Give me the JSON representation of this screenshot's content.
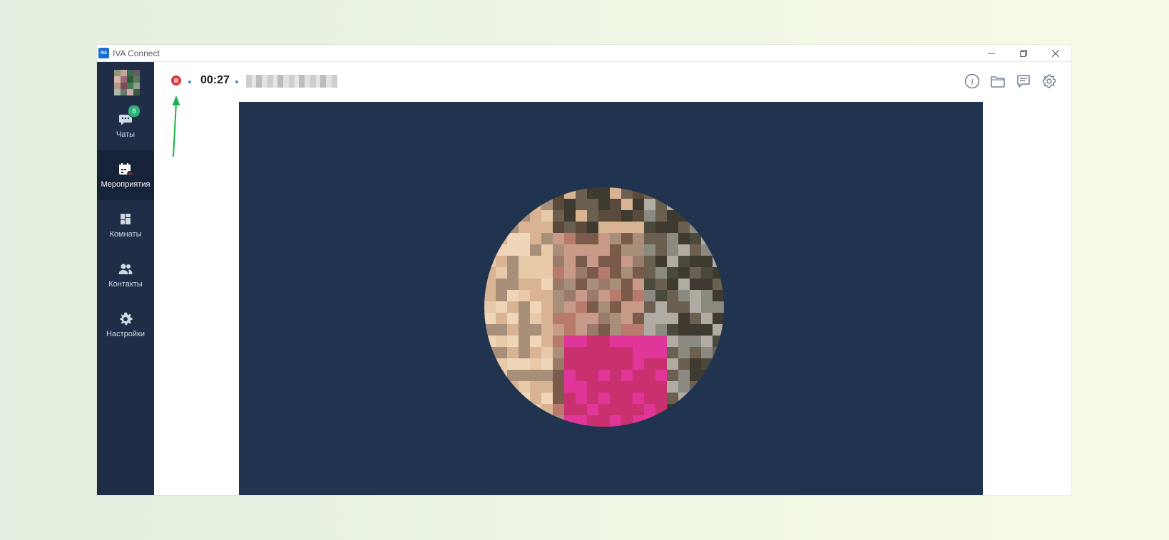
{
  "window": {
    "title": "IVA Connect",
    "logo_text": "IVA"
  },
  "sidebar": {
    "items": [
      {
        "label": "Чаты",
        "icon": "chat-icon",
        "badge": "8"
      },
      {
        "label": "Мероприятия",
        "icon": "events-calendar-icon",
        "active": true
      },
      {
        "label": "Комнаты",
        "icon": "rooms-icon"
      },
      {
        "label": "Контакты",
        "icon": "contacts-icon"
      },
      {
        "label": "Настройки",
        "icon": "settings-gear-icon"
      }
    ]
  },
  "call": {
    "timer": "00:27",
    "recording_color": "#e0333d"
  },
  "toolbar": {
    "icons": [
      "info-icon",
      "folder-icon",
      "chat-panel-icon",
      "settings-icon"
    ]
  },
  "colors": {
    "sidebar_bg": "#1f2e46",
    "stage_bg": "#21344f",
    "badge": "#2bb37a",
    "annotation_arrow": "#1db34a"
  }
}
